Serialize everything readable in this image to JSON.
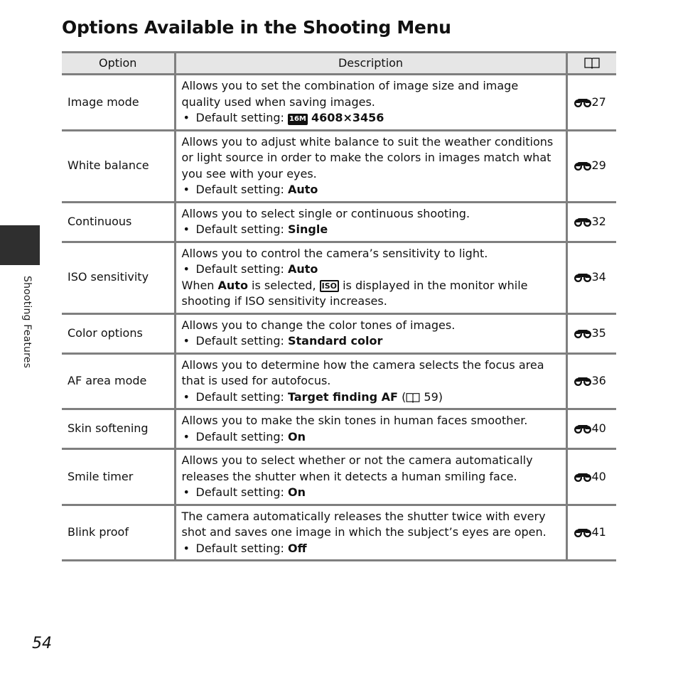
{
  "page": {
    "title": "Options Available in the Shooting Menu",
    "side_label": "Shooting Features",
    "page_number": "54"
  },
  "table": {
    "headers": {
      "option": "Option",
      "description": "Description",
      "reference_icon": "book-icon"
    },
    "default_prefix": "Default setting: ",
    "rows": [
      {
        "option": "Image mode",
        "text": "Allows you to set the combination of image size and image quality used when saving images.",
        "default_icon": "16M",
        "default": "4608×3456",
        "ref": "27"
      },
      {
        "option": "White balance",
        "text": "Allows you to adjust white balance to suit the weather conditions or light source in order to make the colors in images match what you see with your eyes.",
        "default": "Auto",
        "ref": "29"
      },
      {
        "option": "Continuous",
        "text": "Allows you to select single or continuous shooting.",
        "default": "Single",
        "ref": "32"
      },
      {
        "option": "ISO sensitivity",
        "text": "Allows you to control the camera’s sensitivity to light.",
        "default": "Auto",
        "note_pre": "When ",
        "note_bold": "Auto",
        "note_mid": " is selected, ",
        "note_icon": "ISO",
        "note_post": " is displayed in the monitor while shooting if ISO sensitivity increases.",
        "ref": "34"
      },
      {
        "option": "Color options",
        "text": "Allows you to change the color tones of images.",
        "default": "Standard color",
        "ref": "35"
      },
      {
        "option": "AF area mode",
        "text": "Allows you to determine how the camera selects the focus area that is used for autofocus.",
        "default": "Target finding AF",
        "default_suffix_open": " (",
        "default_suffix_page": " 59)",
        "ref": "36"
      },
      {
        "option": "Skin softening",
        "text": "Allows you to make the skin tones in human faces smoother.",
        "default": "On",
        "ref": "40"
      },
      {
        "option": "Smile timer",
        "text": "Allows you to select whether or not the camera automatically releases the shutter when it detects a human smiling face.",
        "default": "On",
        "ref": "40"
      },
      {
        "option": "Blink proof",
        "text": "The camera automatically releases the shutter twice with every shot and saves one image in which the subject’s eyes are open.",
        "default": "Off",
        "ref": "41"
      }
    ]
  }
}
